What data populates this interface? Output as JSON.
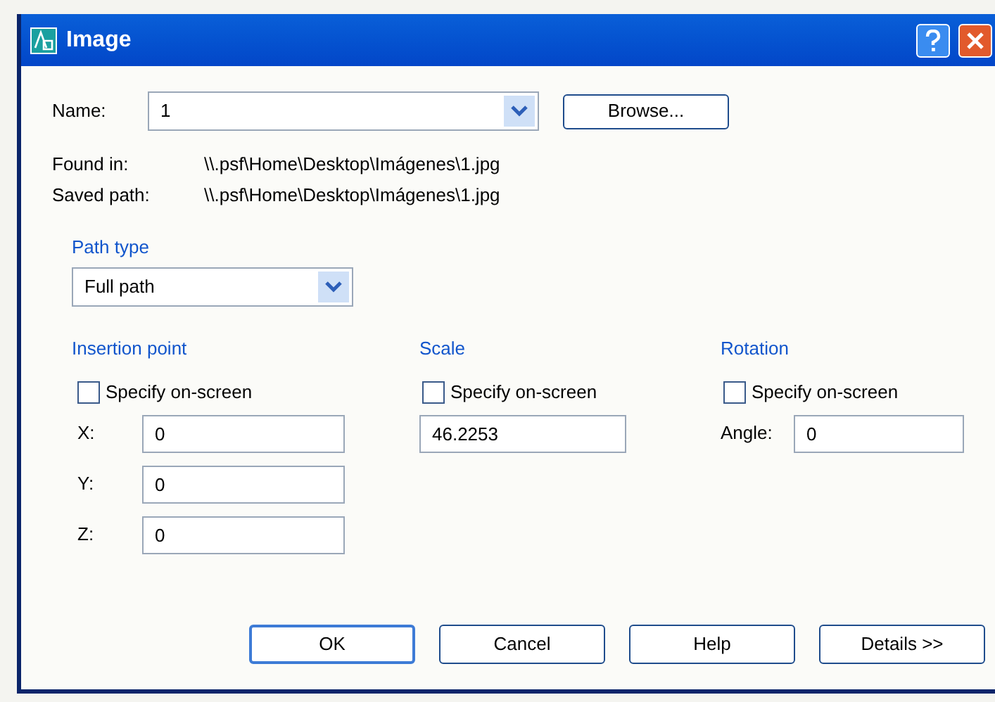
{
  "window": {
    "title": "Image"
  },
  "name": {
    "label": "Name:",
    "value": "1"
  },
  "browse_button": "Browse...",
  "found_in": {
    "label": "Found in:",
    "value": "\\\\.psf\\Home\\Desktop\\Imágenes\\1.jpg"
  },
  "saved_path": {
    "label": "Saved path:",
    "value": "\\\\.psf\\Home\\Desktop\\Imágenes\\1.jpg"
  },
  "path_type": {
    "title": "Path type",
    "value": "Full path"
  },
  "insertion_point": {
    "title": "Insertion point",
    "specify_on_screen": {
      "label": "Specify on-screen",
      "checked": false
    },
    "fields": [
      {
        "label": "X:",
        "value": "0"
      },
      {
        "label": "Y:",
        "value": "0"
      },
      {
        "label": "Z:",
        "value": "0"
      }
    ]
  },
  "scale": {
    "title": "Scale",
    "specify_on_screen": {
      "label": "Specify on-screen",
      "checked": false
    },
    "value": "46.2253"
  },
  "rotation": {
    "title": "Rotation",
    "specify_on_screen": {
      "label": "Specify on-screen",
      "checked": false
    },
    "angle_label": "Angle:",
    "angle_value": "0"
  },
  "buttons": [
    {
      "label": "OK",
      "default": true
    },
    {
      "label": "Cancel",
      "default": false
    },
    {
      "label": "Help",
      "default": false
    },
    {
      "label": "Details >>",
      "default": false
    }
  ]
}
